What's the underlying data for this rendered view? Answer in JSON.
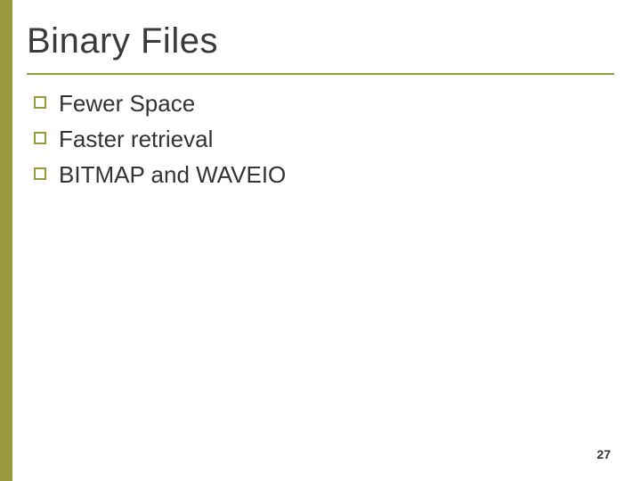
{
  "title": "Binary Files",
  "bullets": [
    {
      "text": "Fewer Space"
    },
    {
      "text": "Faster retrieval"
    },
    {
      "text": "BITMAP and WAVEIO"
    }
  ],
  "page_number": "27"
}
